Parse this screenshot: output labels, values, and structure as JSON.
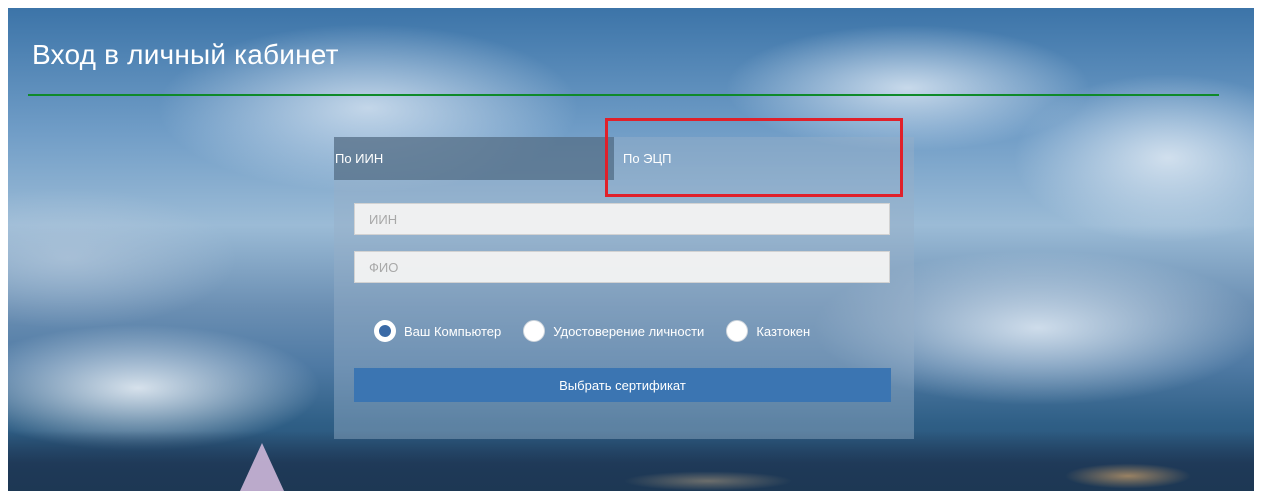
{
  "header": {
    "title": "Вход в личный кабинет"
  },
  "login": {
    "tabs": [
      {
        "label": "По ИИН",
        "active": false
      },
      {
        "label": "По ЭЦП",
        "active": true
      }
    ],
    "fields": {
      "iin": {
        "placeholder": "ИИН",
        "value": ""
      },
      "fio": {
        "placeholder": "ФИО",
        "value": ""
      }
    },
    "storage_options": [
      {
        "label": "Ваш Компьютер",
        "selected": true
      },
      {
        "label": "Удостоверение личности",
        "selected": false
      },
      {
        "label": "Казтокен",
        "selected": false
      }
    ],
    "submit_label": "Выбрать сертификат"
  },
  "colors": {
    "header_rule": "#0f8a2a",
    "highlight": "#e0202a",
    "button": "#3b75b2",
    "radio_selected": "#3a6aa6"
  }
}
